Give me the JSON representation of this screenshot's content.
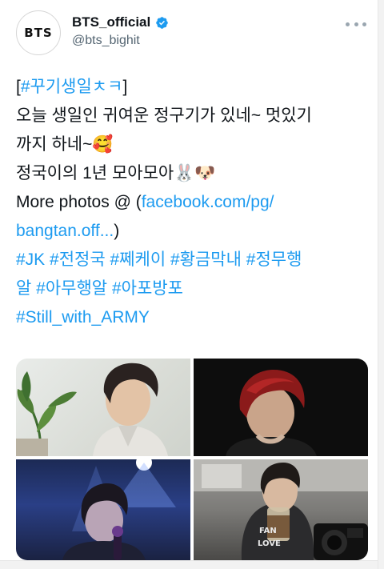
{
  "account": {
    "avatar_text": "BTS",
    "display_name": "BTS_official",
    "handle": "@bts_bighit",
    "verified": true
  },
  "tweet": {
    "lines": [
      {
        "segments": [
          {
            "text": "[",
            "type": "text"
          },
          {
            "text": "#꾸기생일ㅊㅋ",
            "type": "link"
          },
          {
            "text": "]",
            "type": "text"
          }
        ]
      },
      {
        "segments": [
          {
            "text": "오늘 생일인 귀여운 정구기가 있네~ 멋있기",
            "type": "text"
          }
        ]
      },
      {
        "segments": [
          {
            "text": "까지 하네~🥰",
            "type": "text"
          }
        ]
      },
      {
        "segments": [
          {
            "text": "정국이의 1년 모아모아🐰🐶",
            "type": "text"
          }
        ]
      },
      {
        "segments": [
          {
            "text": "More photos @ (",
            "type": "text"
          },
          {
            "text": "facebook.com/pg/",
            "type": "link"
          }
        ]
      },
      {
        "segments": [
          {
            "text": "bangtan.off...",
            "type": "link"
          },
          {
            "text": ")",
            "type": "text"
          }
        ]
      },
      {
        "segments": [
          {
            "text": "#JK #전정국 #쩨케이 #황금막내 #정무행",
            "type": "link"
          }
        ]
      },
      {
        "segments": [
          {
            "text": "알 #아무행알 #아포방포",
            "type": "link"
          }
        ]
      },
      {
        "segments": [
          {
            "text": "#Still_with_ARMY",
            "type": "link"
          }
        ]
      }
    ]
  },
  "media": {
    "photos": [
      {
        "name": "photo-1"
      },
      {
        "name": "photo-2"
      },
      {
        "name": "photo-3"
      },
      {
        "name": "photo-4"
      }
    ]
  },
  "colors": {
    "link": "#1d9bf0",
    "text": "#0f1419",
    "secondary": "#536471"
  },
  "icons": {
    "verified": "verified-badge-icon",
    "more": "more-options-icon"
  }
}
